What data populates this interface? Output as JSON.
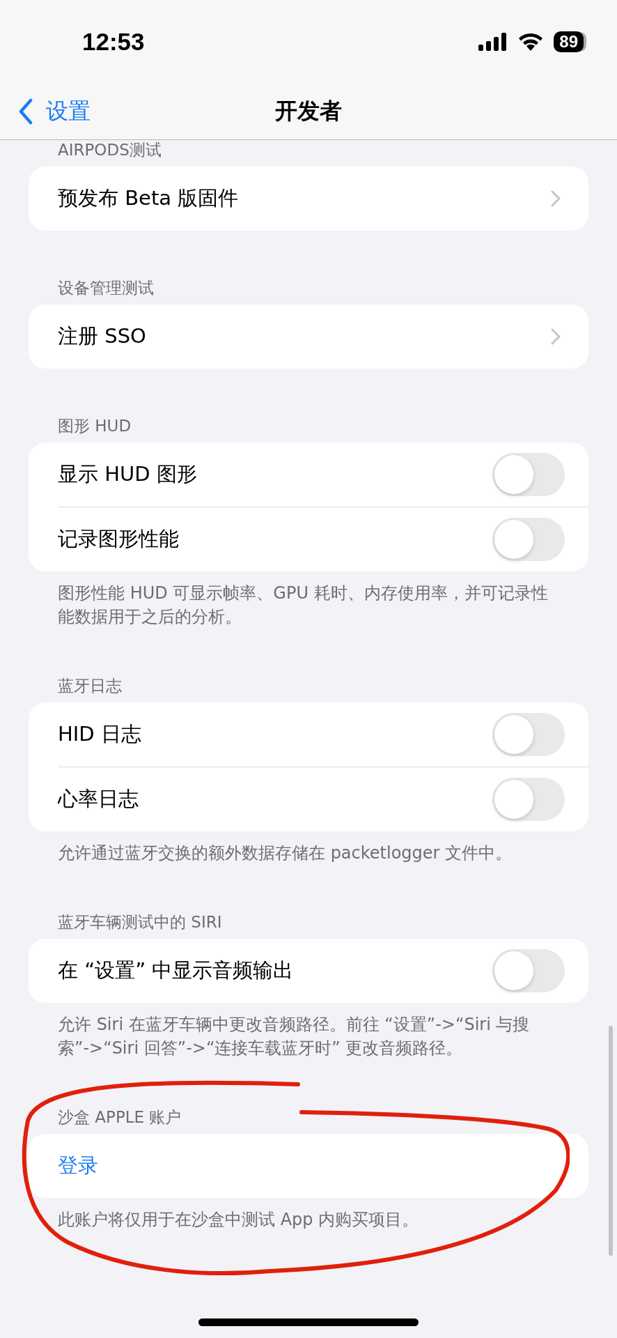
{
  "status_bar": {
    "time": "12:53",
    "battery": "89"
  },
  "nav": {
    "back": "设置",
    "title": "开发者"
  },
  "sections": [
    {
      "header": "AIRPODS测试",
      "rows": [
        {
          "kind": "link",
          "label": "预发布 Beta 版固件"
        }
      ]
    },
    {
      "header": "设备管理测试",
      "rows": [
        {
          "kind": "link",
          "label": "注册 SSO"
        }
      ]
    },
    {
      "header": "图形 HUD",
      "rows": [
        {
          "kind": "toggle",
          "label": "显示 HUD 图形",
          "on": false
        },
        {
          "kind": "toggle",
          "label": "记录图形性能",
          "on": false
        }
      ],
      "footer": "图形性能 HUD 可显示帧率、GPU 耗时、内存使用率，并可记录性能数据用于之后的分析。"
    },
    {
      "header": "蓝牙日志",
      "rows": [
        {
          "kind": "toggle",
          "label": "HID 日志",
          "on": false
        },
        {
          "kind": "toggle",
          "label": "心率日志",
          "on": false
        }
      ],
      "footer": "允许通过蓝牙交换的额外数据存储在 packetlogger 文件中。"
    },
    {
      "header": "蓝牙车辆测试中的 SIRI",
      "rows": [
        {
          "kind": "toggle",
          "label": "在 “设置” 中显示音频输出",
          "on": false
        }
      ],
      "footer": "允许 Siri 在蓝牙车辆中更改音频路径。前往 “设置”->“Siri 与搜索”->“Siri 回答”->“连接车载蓝牙时” 更改音频路径。"
    },
    {
      "header": "沙盒 APPLE 账户",
      "rows": [
        {
          "kind": "action",
          "label": "登录"
        }
      ],
      "footer": "此账户将仅用于在沙盒中测试 App 内购买项目。"
    }
  ]
}
